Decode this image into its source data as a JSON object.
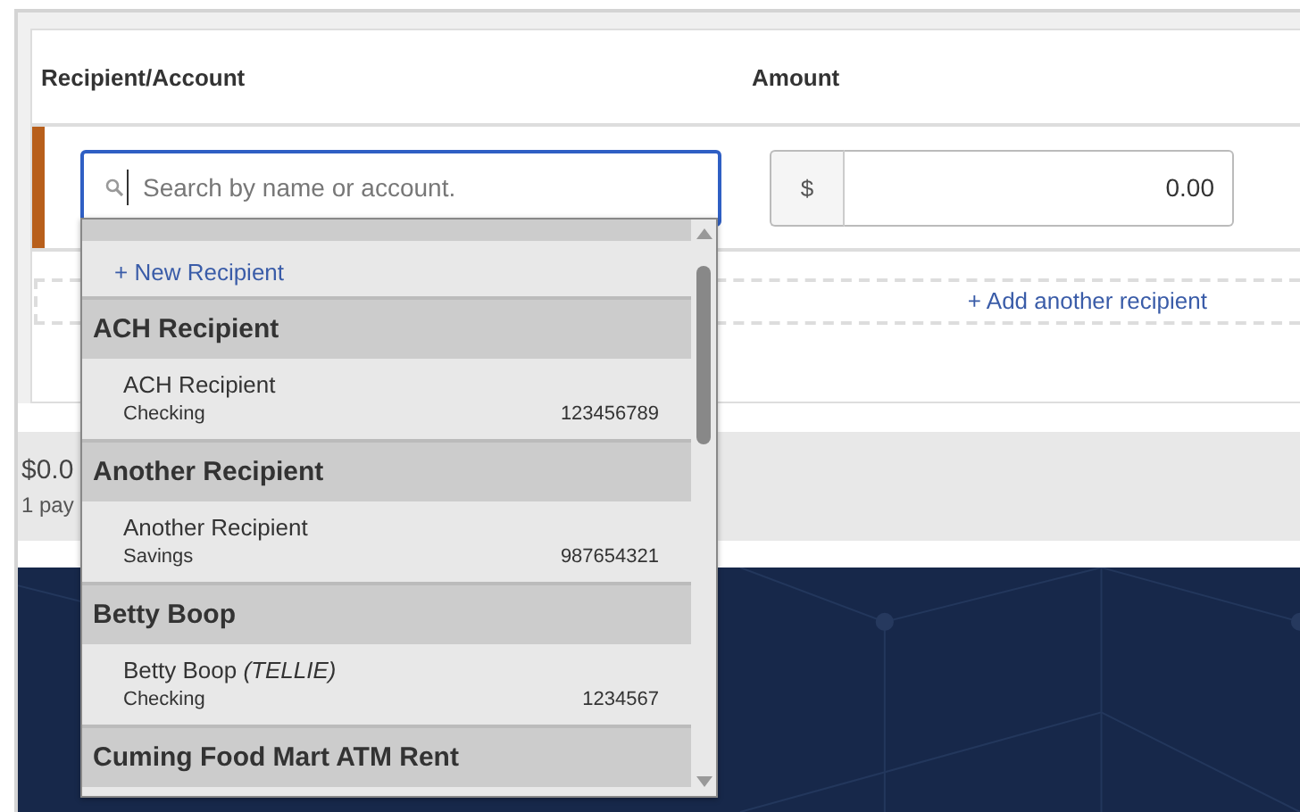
{
  "columns": [
    {
      "label": "Recipient/Account"
    },
    {
      "label": "Amount"
    }
  ],
  "payment_row": {
    "search": {
      "placeholder": "Search by name or account."
    },
    "currency": "$",
    "amount": "0.00"
  },
  "add_link": "+ Add another recipient",
  "summary": {
    "total": "$0.0",
    "count": "1 pay"
  },
  "dropdown": {
    "new_link": "+ New Recipient",
    "groups": [
      {
        "name": "ACH Recipient",
        "accounts": [
          {
            "name": "ACH Recipient",
            "type": "Checking",
            "number": "123456789"
          }
        ]
      },
      {
        "name": "Another Recipient",
        "accounts": [
          {
            "name": "Another Recipient",
            "type": "Savings",
            "number": "987654321"
          }
        ]
      },
      {
        "name": "Betty Boop",
        "accounts": [
          {
            "name": "Betty Boop *(TELLIE)*",
            "type": "Checking",
            "number": "1234567"
          }
        ]
      },
      {
        "name": "Cuming Food Mart ATM Rent"
      }
    ]
  }
}
